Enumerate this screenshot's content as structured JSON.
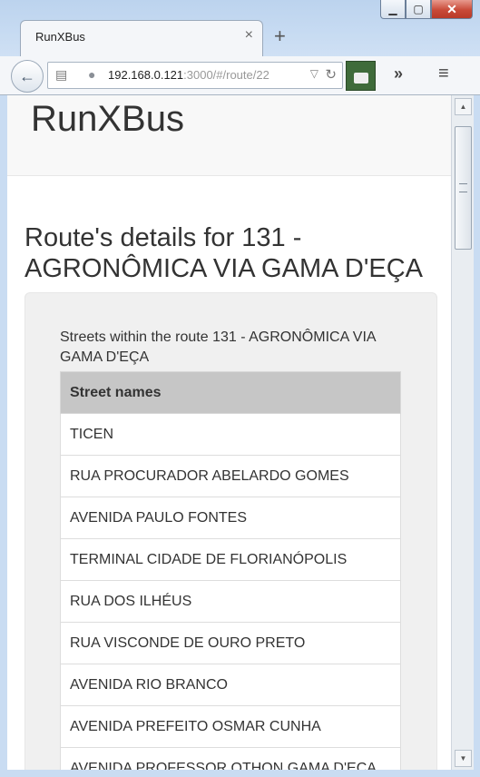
{
  "browser": {
    "tab_title": "RunXBus",
    "tab_close": "×",
    "new_tab": "+",
    "url_host": "192.168.0.121",
    "url_rest": ":3000/#/route/22",
    "window_buttons": {
      "minimize": "▁",
      "maximize": "▢",
      "close": "✕"
    },
    "icons": {
      "back": "back-arrow-icon",
      "reader": "reader-view-icon",
      "globe": "globe-icon",
      "dropdown": "dropdown-arrow-icon",
      "reload": "reload-icon",
      "overflow": "overflow-chevron-icon",
      "menu": "hamburger-menu-icon"
    }
  },
  "app": {
    "brand": "RunXBus",
    "page_title": "Route's details for 131 - AGRONÔMICA VIA GAMA D'EÇA",
    "streets_caption": "Streets within the route 131 - AGRONÔMICA VIA GAMA D'EÇA",
    "table_header": "Street names",
    "streets": [
      "TICEN",
      "RUA PROCURADOR ABELARDO GOMES",
      "AVENIDA PAULO FONTES",
      "TERMINAL CIDADE DE FLORIANÓPOLIS",
      "RUA DOS ILHÉUS",
      "RUA VISCONDE DE OURO PRETO",
      "AVENIDA RIO BRANCO",
      "AVENIDA PREFEITO OSMAR CUNHA",
      "AVENIDA PROFESSOR OTHON GAMA D'EÇA"
    ]
  },
  "colors": {
    "header_bg": "#f8f8f8",
    "well_bg": "#f0f0f0",
    "table_header_bg": "#c6c6c6",
    "text": "#333333"
  }
}
